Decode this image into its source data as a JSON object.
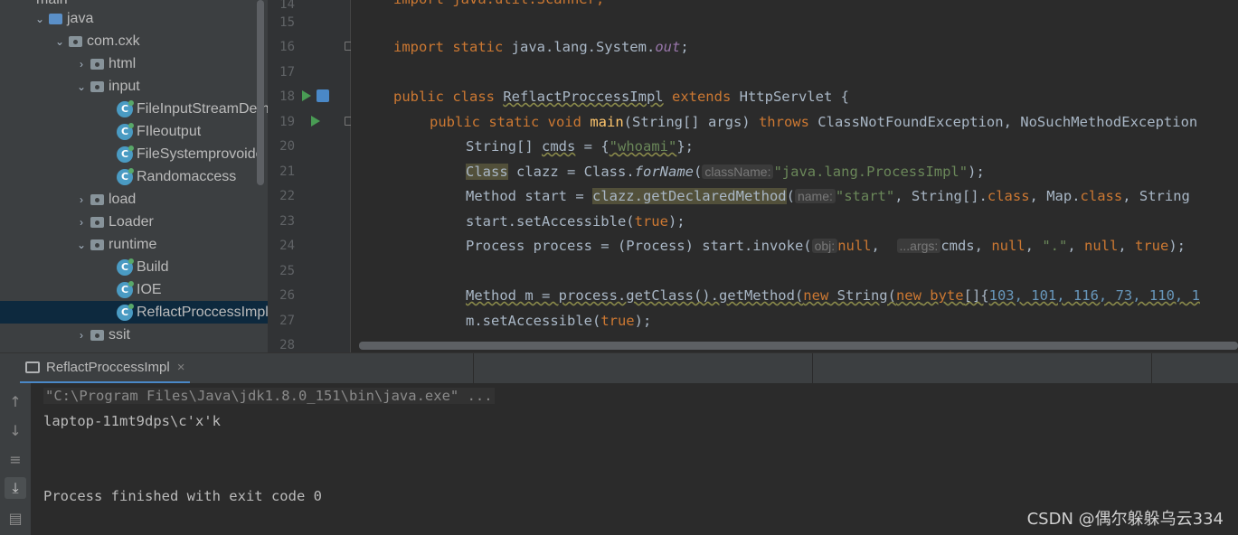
{
  "project_tree": {
    "top_partial": "main",
    "items": [
      {
        "label": "java",
        "kind": "folder",
        "expanded": true,
        "indent": 1
      },
      {
        "label": "com.cxk",
        "kind": "package",
        "expanded": true,
        "indent": 2
      },
      {
        "label": "html",
        "kind": "package",
        "expanded": false,
        "indent": 3
      },
      {
        "label": "input",
        "kind": "package",
        "expanded": true,
        "indent": 3
      },
      {
        "label": "FileInputStreamDem",
        "kind": "class",
        "indent": 4
      },
      {
        "label": "FIleoutput",
        "kind": "class",
        "indent": 4
      },
      {
        "label": "FileSystemprovoide",
        "kind": "class",
        "indent": 4
      },
      {
        "label": "Randomaccess",
        "kind": "class",
        "indent": 4
      },
      {
        "label": "load",
        "kind": "package",
        "expanded": false,
        "indent": 3
      },
      {
        "label": "Loader",
        "kind": "package",
        "expanded": false,
        "indent": 3
      },
      {
        "label": "runtime",
        "kind": "package",
        "expanded": true,
        "indent": 3
      },
      {
        "label": "Build",
        "kind": "class",
        "indent": 4
      },
      {
        "label": "IOE",
        "kind": "class",
        "indent": 4
      },
      {
        "label": "ReflactProccessImpl",
        "kind": "class",
        "indent": 4,
        "selected": true
      },
      {
        "label": "ssit",
        "kind": "package",
        "expanded": false,
        "indent": 3
      }
    ]
  },
  "editor": {
    "line_numbers": [
      "14",
      "15",
      "16",
      "17",
      "18",
      "19",
      "20",
      "21",
      "22",
      "23",
      "24",
      "25",
      "26",
      "27",
      "28"
    ],
    "lines": {
      "l14": "import java.util.Scanner;",
      "l16_import": "import static",
      "l16_rest": " java.lang.System.",
      "l16_out": "out",
      "l16_end": ";",
      "l18_a": "public class",
      "l18_cls": "ReflactProccessImpl",
      "l18_ext": "extends",
      "l18_end": " HttpServlet {",
      "l19_mods": "public static void",
      "l19_main": "main",
      "l19_args": "(String[] args) ",
      "l19_throws": "throws",
      "l19_end": " ClassNotFoundException, NoSuchMethodException",
      "l20_a": "String[] ",
      "l20_var": "cmds",
      "l20_b": " = {",
      "l20_str": "\"whoami\"",
      "l20_end": "};",
      "l21_cls": "Class",
      "l21_b": " clazz = Class.",
      "l21_fn": "forName",
      "l21_c": "(",
      "l21_hint": "className:",
      "l21_str": "\"java.lang.ProcessImpl\"",
      "l21_end": ");",
      "l22_a": "Method start = ",
      "l22_hl": "clazz.getDeclaredMethod",
      "l22_c": "(",
      "l22_hint": "name:",
      "l22_str": "\"start\"",
      "l22_d": ", String[].",
      "l22_kw1": "class",
      "l22_e": ", Map.",
      "l22_kw2": "class",
      "l22_end": ", String",
      "l23_a": "start.setAccessible(",
      "l23_kw": "true",
      "l23_end": ");",
      "l24_a": "Process process = (Process) start.invoke(",
      "l24_hint1": "obj:",
      "l24_null1": "null",
      "l24_b": ",  ",
      "l24_hint2": "...args:",
      "l24_c": "cmds, ",
      "l24_null2": "null",
      "l24_d": ", ",
      "l24_str": "\".\"",
      "l24_e": ", ",
      "l24_null3": "null",
      "l24_f": ", ",
      "l24_true": "true",
      "l24_end": ");",
      "l26_a": "Method m = process.getClass().getMethod(",
      "l26_new1": "new",
      "l26_b": " String(",
      "l26_new2": "new",
      "l26_byte": " byte",
      "l26_c": "[]{",
      "l26_nums": "103, 101, 116, 73, 110, 1",
      "l27_a": "m.setAccessible(",
      "l27_kw": "true",
      "l27_end": ");"
    }
  },
  "run_panel": {
    "tab_label": "ReflactProccessImpl",
    "console": {
      "command": "\"C:\\Program Files\\Java\\jdk1.8.0_151\\bin\\java.exe\" ...",
      "output": "laptop-11mt9dps\\c'x'k",
      "finish": "Process finished with exit code 0"
    }
  },
  "watermark": "CSDN @偶尔躲躲乌云334",
  "colors": {
    "editor_bg": "#2b2b2b",
    "panel_bg": "#3c3f41",
    "keyword": "#cc7832",
    "string": "#6a8759",
    "number": "#6897bb",
    "method": "#ffc66d",
    "selection": "#0d293e"
  }
}
